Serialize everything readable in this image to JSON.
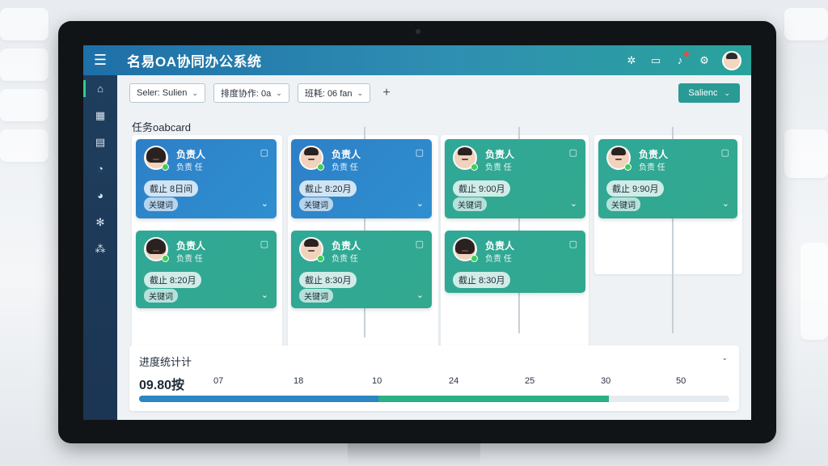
{
  "app": {
    "title": "名易OA协同办公系统",
    "menu_icon": "menu-icon"
  },
  "header": {
    "icons": [
      "share-icon",
      "chat-icon",
      "bell-icon",
      "gear-icon",
      "avatar"
    ]
  },
  "sidebar": {
    "items": [
      {
        "icon": "home-icon",
        "active": true
      },
      {
        "icon": "grid-icon",
        "active": false
      },
      {
        "icon": "calendar-icon",
        "active": false
      },
      {
        "icon": "chart-icon",
        "active": false
      },
      {
        "icon": "pie-chart-icon",
        "active": false
      },
      {
        "icon": "settings-icon",
        "active": false
      },
      {
        "icon": "nodes-icon",
        "active": false
      }
    ]
  },
  "toolbar": {
    "filters": [
      {
        "label": "Seler: Sulien"
      },
      {
        "label": "排度协作: 0a"
      },
      {
        "label": "班耗: 06 fan"
      }
    ],
    "primary_label": "Salienc"
  },
  "board": {
    "title": "任务oabcard",
    "columns": [
      {
        "cards": [
          {
            "name": "负责人",
            "role": "负责 任",
            "deadline": "截止 8日间",
            "tag": "关键词",
            "color": "blue"
          },
          {
            "name": "负责人",
            "role": "负责 任",
            "deadline": "截止 8:20月",
            "tag": "关键词",
            "color": "teal"
          }
        ]
      },
      {
        "cards": [
          {
            "name": "负责人",
            "role": "负责 任",
            "deadline": "截止 8:20月",
            "tag": "关键词",
            "color": "blue"
          },
          {
            "name": "负责人",
            "role": "负责 任",
            "deadline": "截止 8:30月",
            "tag": "关键词",
            "color": "teal"
          }
        ]
      },
      {
        "cards": [
          {
            "name": "负责人",
            "role": "负责 任",
            "deadline": "截止 9:00月",
            "tag": "关键词",
            "color": "teal"
          },
          {
            "name": "负责人",
            "role": "负责 任",
            "deadline": "截止 8:30月",
            "tag": "",
            "color": "teal"
          }
        ]
      },
      {
        "cards": [
          {
            "name": "负责人",
            "role": "负责 任",
            "deadline": "截止 9:90月",
            "tag": "关键词",
            "color": "teal"
          }
        ]
      }
    ]
  },
  "progress": {
    "title": "进度统计计",
    "value": "09.80按",
    "ticks": [
      "07",
      "18",
      "10",
      "24",
      "25",
      "30",
      "50"
    ],
    "segment_a_fraction": 0.405,
    "segment_b_fraction": 0.39,
    "colors": {
      "a": "#2b86c1",
      "b": "#2bb086"
    }
  }
}
